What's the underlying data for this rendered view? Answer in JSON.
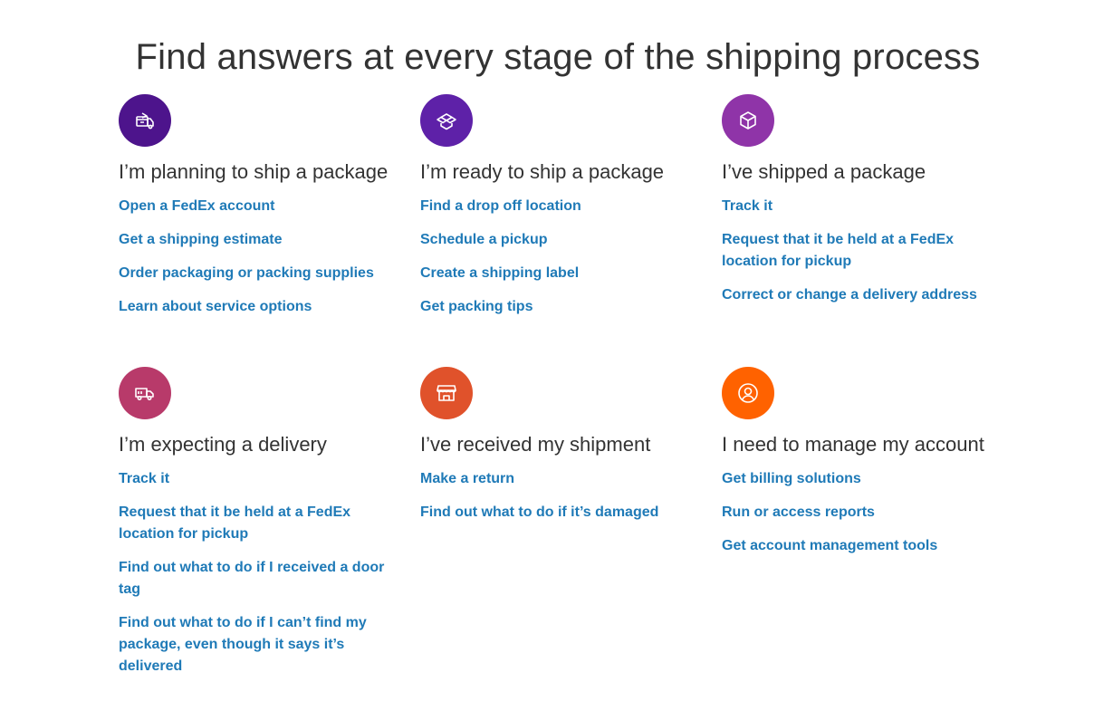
{
  "page": {
    "title": "Find answers at every stage of the shipping process"
  },
  "colors": {
    "link": "#1f7ab7",
    "heading": "#333333",
    "card_icons": [
      "#4d148c",
      "#5e21a8",
      "#8f34a8",
      "#b83a6a",
      "#e0522b",
      "#ff6200"
    ]
  },
  "cards": [
    {
      "icon": "package-delivery-planning-icon",
      "title": "I’m planning to ship a package",
      "links": [
        "Open a FedEx account",
        "Get a shipping estimate",
        "Order packaging or packing supplies",
        "Learn about service options"
      ]
    },
    {
      "icon": "open-box-icon",
      "title": "I’m ready to ship a package",
      "links": [
        "Find a drop off location",
        "Schedule a pickup",
        "Create a shipping label",
        "Get packing tips"
      ]
    },
    {
      "icon": "closed-box-icon",
      "title": "I’ve shipped a package",
      "links": [
        "Track it",
        "Request that it be held at a FedEx location for pickup",
        "Correct or change a delivery address"
      ]
    },
    {
      "icon": "delivery-truck-icon",
      "title": "I’m expecting a delivery",
      "links": [
        "Track it",
        "Request that it be held at a FedEx location for pickup",
        "Find out what to do if I received a door tag",
        "Find out what to do if I can’t find my package, even though it says it’s delivered"
      ]
    },
    {
      "icon": "storefront-icon",
      "title": "I’ve received my shipment",
      "links": [
        "Make a return",
        "Find out what to do if it’s damaged"
      ]
    },
    {
      "icon": "user-account-icon",
      "title": "I need to manage my account",
      "links": [
        "Get billing solutions",
        "Run or access reports",
        "Get account management tools"
      ]
    }
  ]
}
